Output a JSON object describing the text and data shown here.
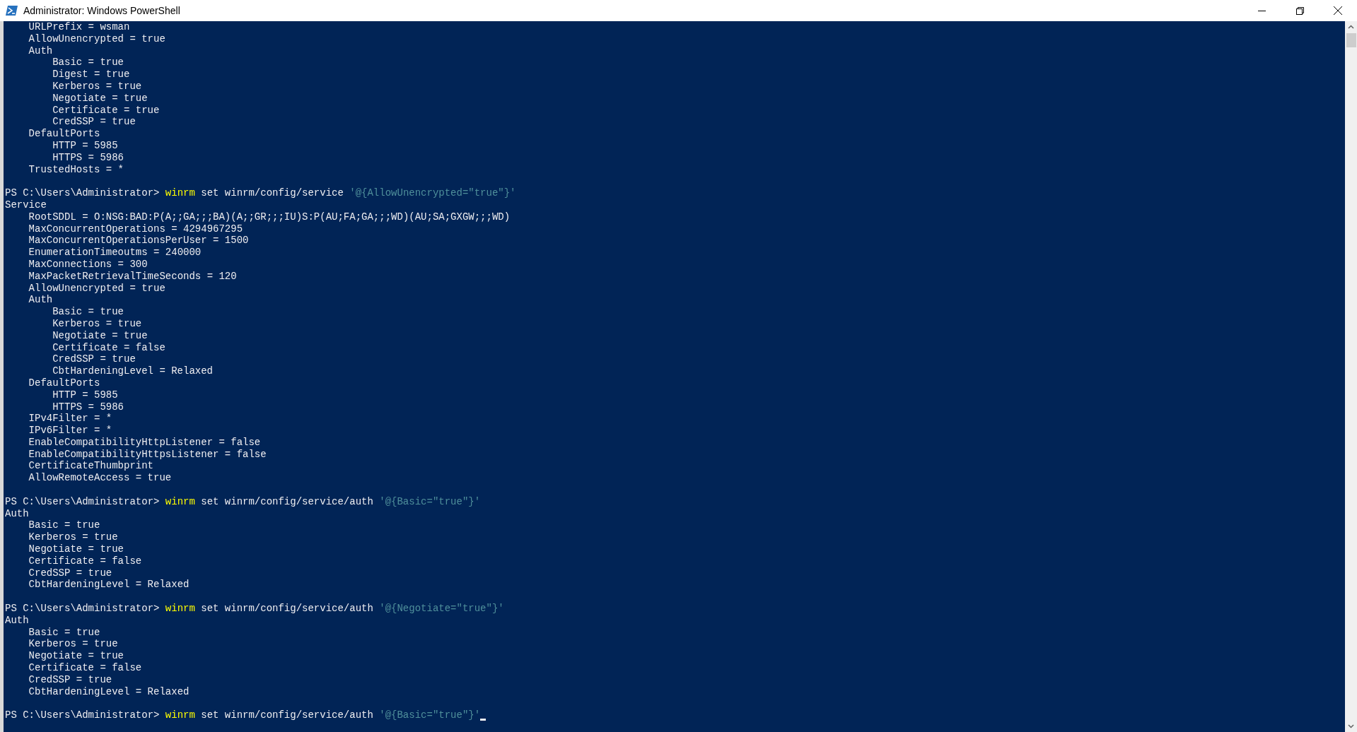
{
  "window": {
    "title": "Administrator: Windows PowerShell"
  },
  "blocks": [
    {
      "output": [
        {
          "text": "URLPrefix = wsman"
        },
        {
          "text": "AllowUnencrypted = true"
        },
        {
          "text": "Auth",
          "children": [
            {
              "text": "Basic = true"
            },
            {
              "text": "Digest = true"
            },
            {
              "text": "Kerberos = true"
            },
            {
              "text": "Negotiate = true"
            },
            {
              "text": "Certificate = true"
            },
            {
              "text": "CredSSP = true"
            }
          ]
        },
        {
          "text": "DefaultPorts",
          "children": [
            {
              "text": "HTTP = 5985"
            },
            {
              "text": "HTTPS = 5986"
            }
          ]
        },
        {
          "text": "TrustedHosts = *"
        }
      ]
    },
    {
      "prompt": "PS C:\\Users\\Administrator>",
      "command": "winrm",
      "arguments": "set winrm/config/service",
      "string": "'@{AllowUnencrypted=\"true\"}'",
      "output": [
        {
          "text": "Service",
          "children": [
            {
              "text": "RootSDDL = O:NSG:BAD:P(A;;GA;;;BA)(A;;GR;;;IU)S:P(AU;FA;GA;;;WD)(AU;SA;GXGW;;;WD)"
            },
            {
              "text": "MaxConcurrentOperations = 4294967295"
            },
            {
              "text": "MaxConcurrentOperationsPerUser = 1500"
            },
            {
              "text": "EnumerationTimeoutms = 240000"
            },
            {
              "text": "MaxConnections = 300"
            },
            {
              "text": "MaxPacketRetrievalTimeSeconds = 120"
            },
            {
              "text": "AllowUnencrypted = true"
            },
            {
              "text": "Auth",
              "children": [
                {
                  "text": "Basic = true"
                },
                {
                  "text": "Kerberos = true"
                },
                {
                  "text": "Negotiate = true"
                },
                {
                  "text": "Certificate = false"
                },
                {
                  "text": "CredSSP = true"
                },
                {
                  "text": "CbtHardeningLevel = Relaxed"
                }
              ]
            },
            {
              "text": "DefaultPorts",
              "children": [
                {
                  "text": "HTTP = 5985"
                },
                {
                  "text": "HTTPS = 5986"
                }
              ]
            },
            {
              "text": "IPv4Filter = *"
            },
            {
              "text": "IPv6Filter = *"
            },
            {
              "text": "EnableCompatibilityHttpListener = false"
            },
            {
              "text": "EnableCompatibilityHttpsListener = false"
            },
            {
              "text": "CertificateThumbprint"
            },
            {
              "text": "AllowRemoteAccess = true"
            }
          ]
        }
      ]
    },
    {
      "prompt": "PS C:\\Users\\Administrator>",
      "command": "winrm",
      "arguments": "set winrm/config/service/auth",
      "string": "'@{Basic=\"true\"}'",
      "output": [
        {
          "text": "Auth",
          "children": [
            {
              "text": "Basic = true"
            },
            {
              "text": "Kerberos = true"
            },
            {
              "text": "Negotiate = true"
            },
            {
              "text": "Certificate = false"
            },
            {
              "text": "CredSSP = true"
            },
            {
              "text": "CbtHardeningLevel = Relaxed"
            }
          ]
        }
      ]
    },
    {
      "prompt": "PS C:\\Users\\Administrator>",
      "command": "winrm",
      "arguments": "set winrm/config/service/auth",
      "string": "'@{Negotiate=\"true\"}'",
      "output": [
        {
          "text": "Auth",
          "children": [
            {
              "text": "Basic = true"
            },
            {
              "text": "Kerberos = true"
            },
            {
              "text": "Negotiate = true"
            },
            {
              "text": "Certificate = false"
            },
            {
              "text": "CredSSP = true"
            },
            {
              "text": "CbtHardeningLevel = Relaxed"
            }
          ]
        }
      ]
    },
    {
      "prompt": "PS C:\\Users\\Administrator>",
      "command": "winrm",
      "arguments": "set winrm/config/service/auth",
      "string": "'@{Basic=\"true\"}'"
    }
  ]
}
